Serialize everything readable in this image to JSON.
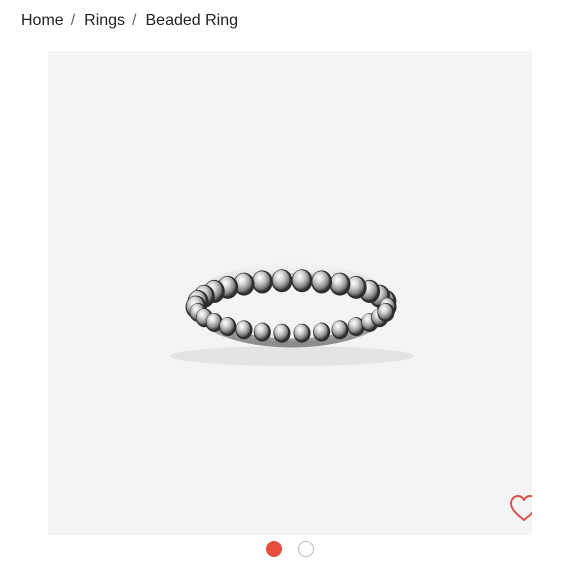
{
  "breadcrumb": {
    "items": [
      "Home",
      "Rings",
      "Beaded Ring"
    ],
    "separator": "/"
  },
  "product_image": {
    "subject": "beaded-ring",
    "background_color": "#f4f4f4"
  },
  "favorite": {
    "icon": "heart-outline-icon",
    "color": "#d9534f"
  },
  "carousel": {
    "total_slides": 2,
    "active_index": 0,
    "active_color": "#e84c3d",
    "inactive_border_color": "#b9b9b9"
  }
}
